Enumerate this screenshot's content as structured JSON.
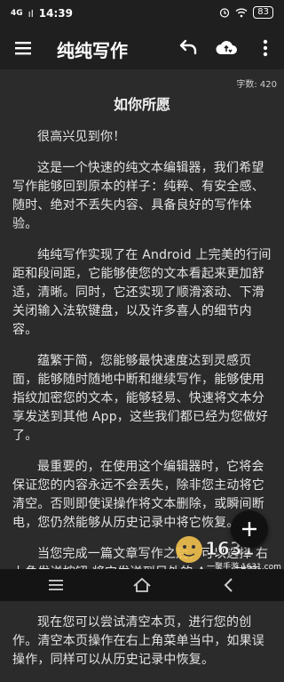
{
  "status_bar": {
    "network": "4G",
    "signal": "ıl",
    "time": "14:39",
    "battery": "83",
    "icons": [
      "4g-icon",
      "signal-icon",
      "alarm-icon",
      "wifi-icon",
      "battery-icon"
    ]
  },
  "toolbar": {
    "title": "纯纯写作",
    "icons": [
      "menu-icon",
      "undo-icon",
      "cloud-sync-icon",
      "more-icon"
    ]
  },
  "document": {
    "word_count": "字数: 420",
    "title": "如你所愿",
    "paragraphs": [
      "很高兴见到你！",
      "这是一个快速的纯文本编辑器，我们希望写作能够回到原本的样子：纯粹、有安全感、随时、绝对不丢失内容、具备良好的写作体验。",
      "纯纯写作实现了在 Android 上完美的行间距和段间距，它能够使您的文本看起来更加舒适，清晰。同时，它还实现了顺滑滚动、下滑关闭输入法软键盘，以及许多喜人的细节内容。",
      "蕴繁于简，您能够最快速度达到灵感页面，能够随时随地中断和继续写作，能够使用指纹加密您的文本，能够轻易、快速将文本分享发送到其他 App，这些我们都已经为您做好了。",
      "最重要的，在使用这个编辑器时，它将会保证您的内容永远不会丢失，除非您主动将它清空。否则即使误操作将文本删除，或瞬间断电，您仍然能够从历史记录中将它恢复。",
      "当您完成一篇文章写作之后，可以选择 右上角发送按钮 将它发送到另外的 App，或开启新篇章。",
      "现在您可以尝试清空本页，进行您的创作。清空本页操作在右上角菜单当中，如果误操作，同样可以从历史记录中恢复。"
    ]
  },
  "fab": {
    "icon": "plus-icon",
    "label": "+"
  },
  "watermark": {
    "logo": "1631",
    "text": "一聚手游 1631.com"
  },
  "nav_bar": {
    "icons": [
      "nav-menu-icon",
      "nav-home-icon",
      "nav-back-icon"
    ]
  },
  "colors": {
    "background": "#2b2b2b",
    "bar": "#1f1f1f",
    "text": "#e4e4e4"
  }
}
